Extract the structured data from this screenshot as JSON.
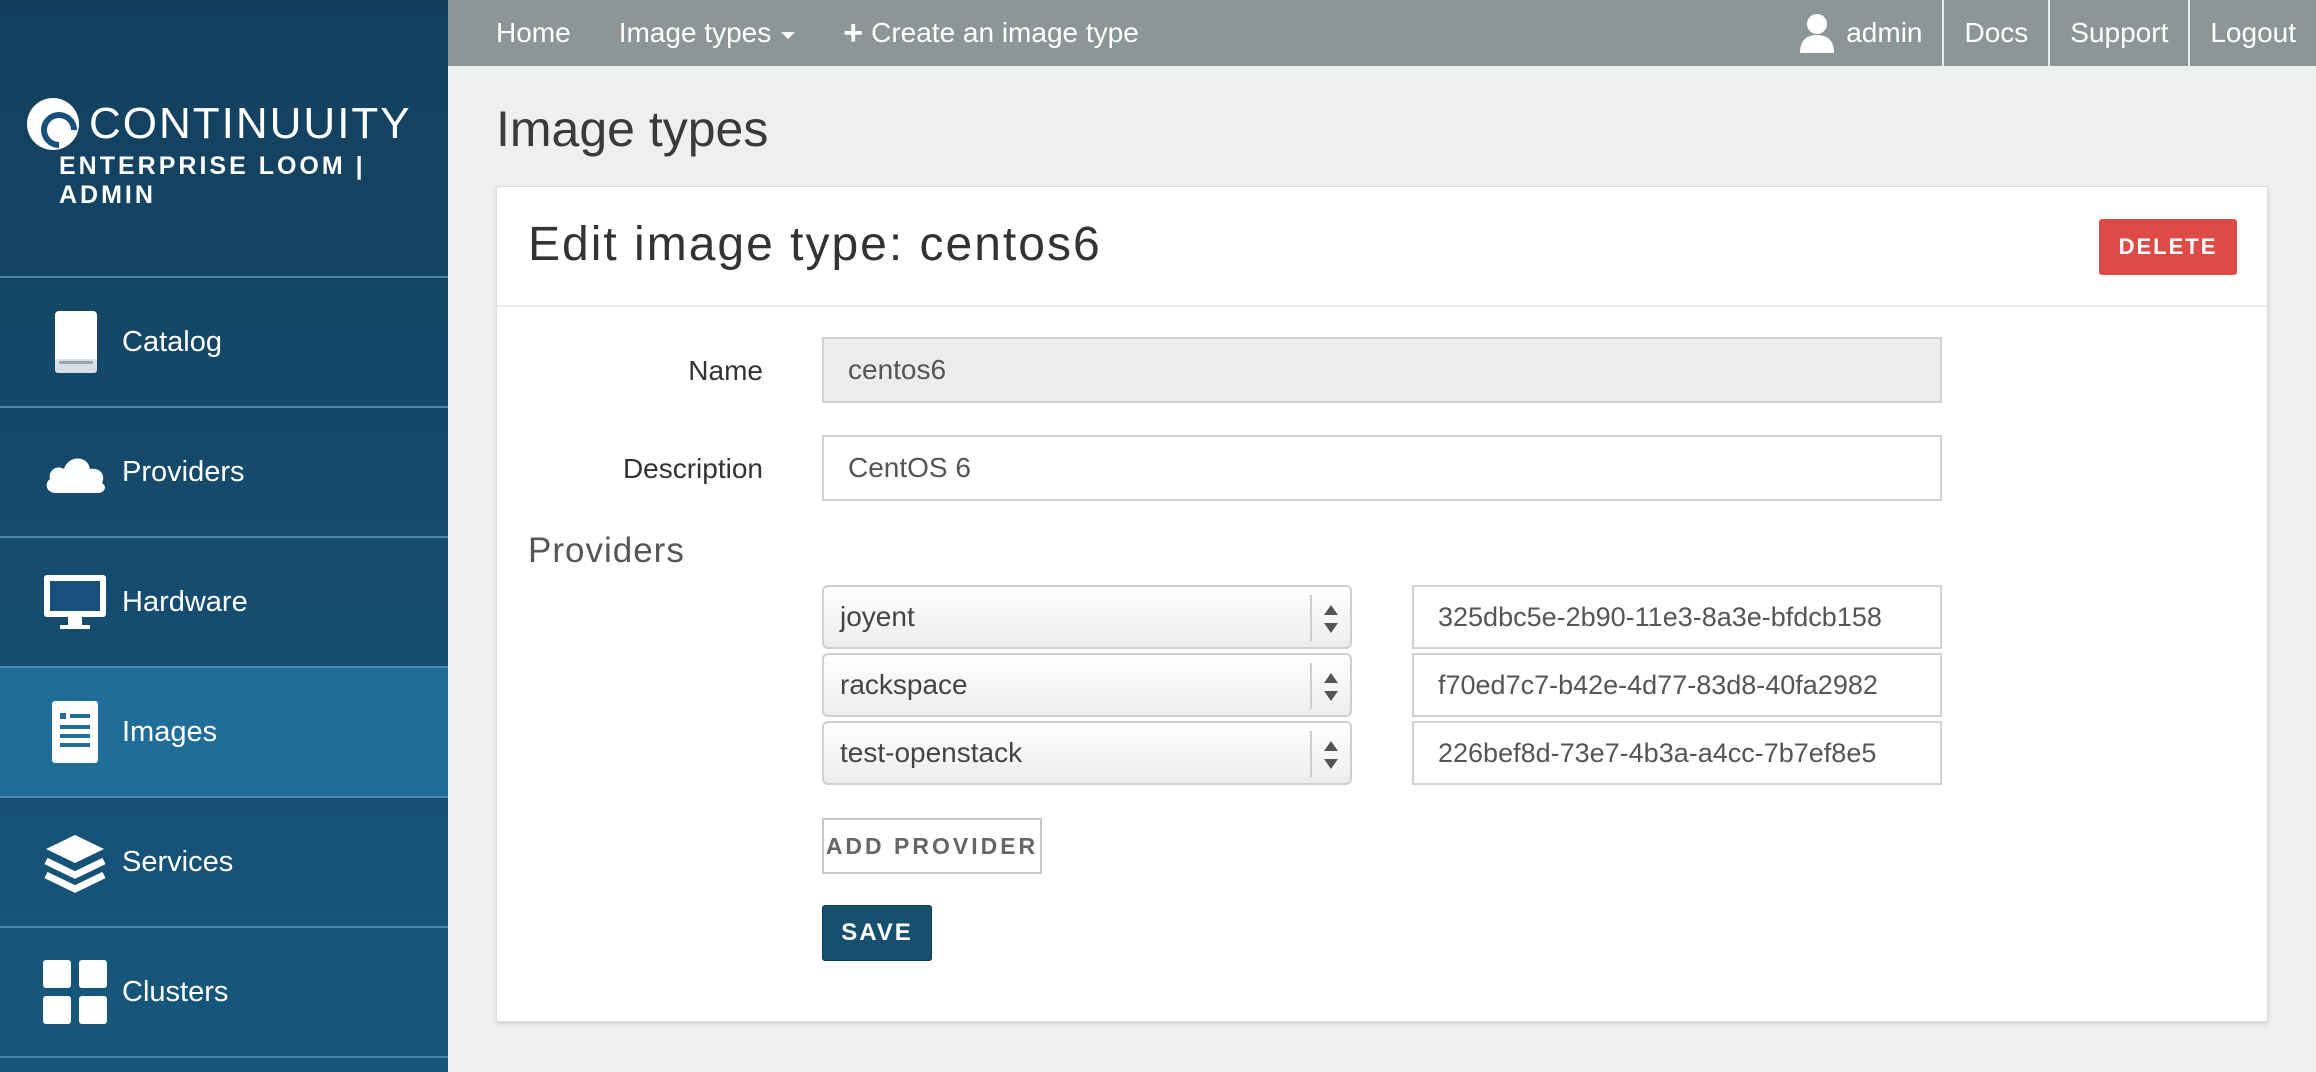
{
  "brand": {
    "name": "CONTINUUITY",
    "subtitle": "ENTERPRISE LOOM | ADMIN"
  },
  "sidebar": {
    "items": [
      {
        "label": "Catalog",
        "icon": "book-icon",
        "active": false
      },
      {
        "label": "Providers",
        "icon": "cloud-icon",
        "active": false
      },
      {
        "label": "Hardware",
        "icon": "monitor-icon",
        "active": false
      },
      {
        "label": "Images",
        "icon": "document-icon",
        "active": true
      },
      {
        "label": "Services",
        "icon": "layers-icon",
        "active": false
      },
      {
        "label": "Clusters",
        "icon": "grid-icon",
        "active": false
      }
    ]
  },
  "topnav": {
    "home": "Home",
    "image_types": "Image types",
    "create": "Create an image type",
    "user": "admin",
    "docs": "Docs",
    "support": "Support",
    "logout": "Logout"
  },
  "page": {
    "title": "Image types"
  },
  "form": {
    "heading": "Edit image type: centos6",
    "delete_label": "DELETE",
    "name_label": "Name",
    "name_value": "centos6",
    "description_label": "Description",
    "description_value": "CentOS 6",
    "providers_heading": "Providers",
    "providers": [
      {
        "provider": "joyent",
        "image_id": "325dbc5e-2b90-11e3-8a3e-bfdcb158"
      },
      {
        "provider": "rackspace",
        "image_id": "f70ed7c7-b42e-4d77-83d8-40fa2982"
      },
      {
        "provider": "test-openstack",
        "image_id": "226bef8d-73e7-4b3a-a4cc-7b7ef8e5"
      }
    ],
    "add_provider_label": "ADD PROVIDER",
    "save_label": "SAVE"
  },
  "colors": {
    "sidebar": "#17507a",
    "topbar": "#8d9696",
    "delete": "#dd4b47",
    "save": "#17506f"
  }
}
